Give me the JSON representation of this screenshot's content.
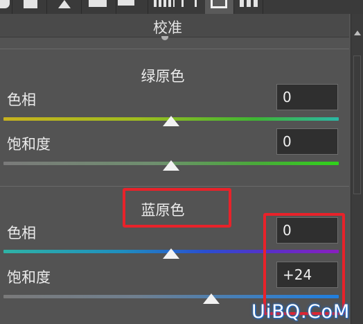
{
  "panel": {
    "title": "校准"
  },
  "sections": [
    {
      "title": "绿原色",
      "rows": [
        {
          "label": "色相",
          "value": "0",
          "level": 0.5
        },
        {
          "label": "饱和度",
          "value": "0",
          "level": 0.5
        }
      ]
    },
    {
      "title": "蓝原色",
      "rows": [
        {
          "label": "色相",
          "value": "0",
          "level": 0.5
        },
        {
          "label": "饱和度",
          "value": "+24",
          "level": 0.62
        }
      ]
    }
  ],
  "watermark": "UiBQ.CoM",
  "colors": {
    "panel_bg": "#535353",
    "highlight": "#e8222a"
  }
}
